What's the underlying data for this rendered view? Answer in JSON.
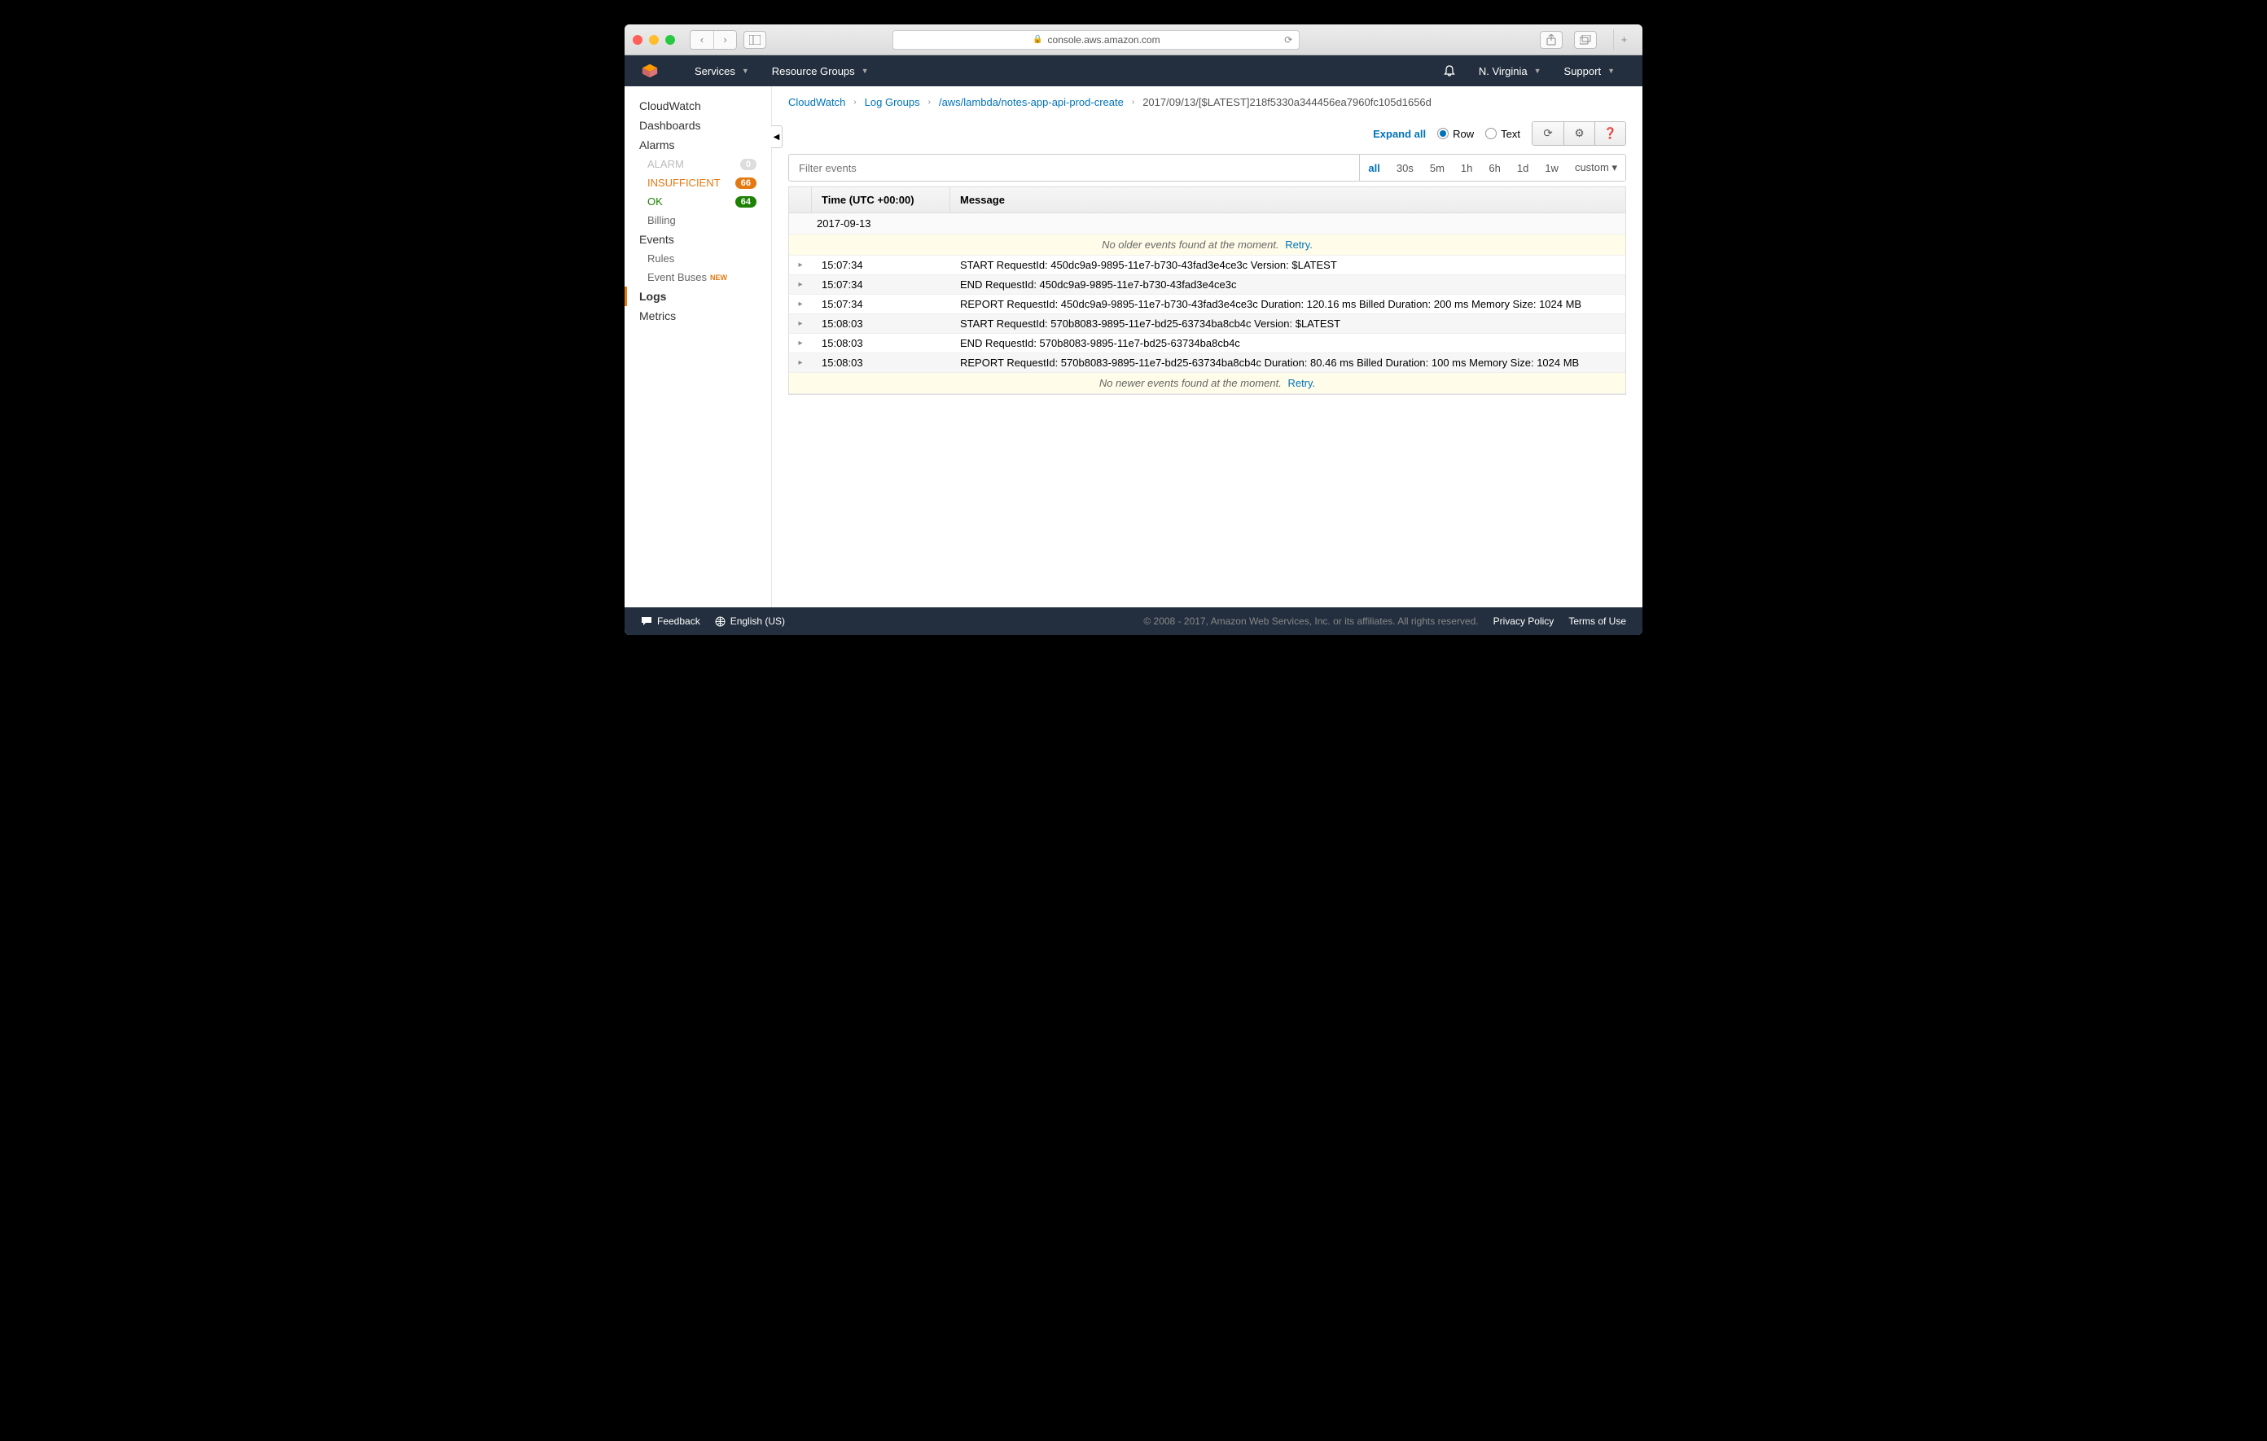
{
  "browser": {
    "url": "console.aws.amazon.com"
  },
  "nav": {
    "services": "Services",
    "resource_groups": "Resource Groups",
    "region": "N. Virginia",
    "support": "Support"
  },
  "sidebar": {
    "cloudwatch": "CloudWatch",
    "dashboards": "Dashboards",
    "alarms": "Alarms",
    "alarm": "ALARM",
    "alarm_count": "0",
    "insufficient": "INSUFFICIENT",
    "insufficient_count": "66",
    "ok": "OK",
    "ok_count": "64",
    "billing": "Billing",
    "events": "Events",
    "rules": "Rules",
    "event_buses": "Event Buses",
    "new_tag": "NEW",
    "logs": "Logs",
    "metrics": "Metrics"
  },
  "breadcrumb": {
    "a": "CloudWatch",
    "b": "Log Groups",
    "c": "/aws/lambda/notes-app-api-prod-create",
    "d": "2017/09/13/[$LATEST]218f5330a344456ea7960fc105d1656d"
  },
  "toolbar": {
    "expand_all": "Expand all",
    "row": "Row",
    "text": "Text"
  },
  "filter": {
    "placeholder": "Filter events",
    "ranges": [
      "all",
      "30s",
      "5m",
      "1h",
      "6h",
      "1d",
      "1w",
      "custom"
    ],
    "active": "all"
  },
  "table": {
    "col_time": "Time (UTC +00:00)",
    "col_message": "Message",
    "date": "2017-09-13",
    "no_older": "No older events found at the moment.",
    "no_newer": "No newer events found at the moment.",
    "retry": "Retry.",
    "rows": [
      {
        "time": "15:07:34",
        "msg": "START RequestId: 450dc9a9-9895-11e7-b730-43fad3e4ce3c Version: $LATEST"
      },
      {
        "time": "15:07:34",
        "msg": "END RequestId: 450dc9a9-9895-11e7-b730-43fad3e4ce3c"
      },
      {
        "time": "15:07:34",
        "msg": "REPORT RequestId: 450dc9a9-9895-11e7-b730-43fad3e4ce3c Duration: 120.16 ms Billed Duration: 200 ms Memory Size: 1024 MB"
      },
      {
        "time": "15:08:03",
        "msg": "START RequestId: 570b8083-9895-11e7-bd25-63734ba8cb4c Version: $LATEST"
      },
      {
        "time": "15:08:03",
        "msg": "END RequestId: 570b8083-9895-11e7-bd25-63734ba8cb4c"
      },
      {
        "time": "15:08:03",
        "msg": "REPORT RequestId: 570b8083-9895-11e7-bd25-63734ba8cb4c Duration: 80.46 ms Billed Duration: 100 ms Memory Size: 1024 MB"
      }
    ]
  },
  "footer": {
    "feedback": "Feedback",
    "language": "English (US)",
    "copy": "© 2008 - 2017, Amazon Web Services, Inc. or its affiliates. All rights reserved.",
    "privacy": "Privacy Policy",
    "terms": "Terms of Use"
  }
}
